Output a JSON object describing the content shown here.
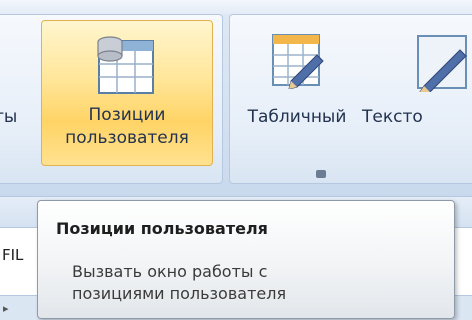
{
  "ribbon": {
    "cut_label": "ты",
    "active_button": {
      "line1": "Позиции",
      "line2": "пользователя",
      "icon": "database-table-icon"
    },
    "table_button": {
      "label": "Табличный",
      "icon": "table-edit-icon"
    },
    "text_button": {
      "label": "Тексто",
      "icon": "pencil-icon"
    }
  },
  "background": {
    "fil_text": "FIL"
  },
  "tooltip": {
    "title": "Позиции пользователя",
    "desc_line1": "Вызвать окно работы с",
    "desc_line2": "позициями пользователя"
  },
  "colors": {
    "ribbon_bg": "#d3e1f1",
    "active_highlight": "#ffd466",
    "tooltip_border": "#8d9aa8"
  }
}
